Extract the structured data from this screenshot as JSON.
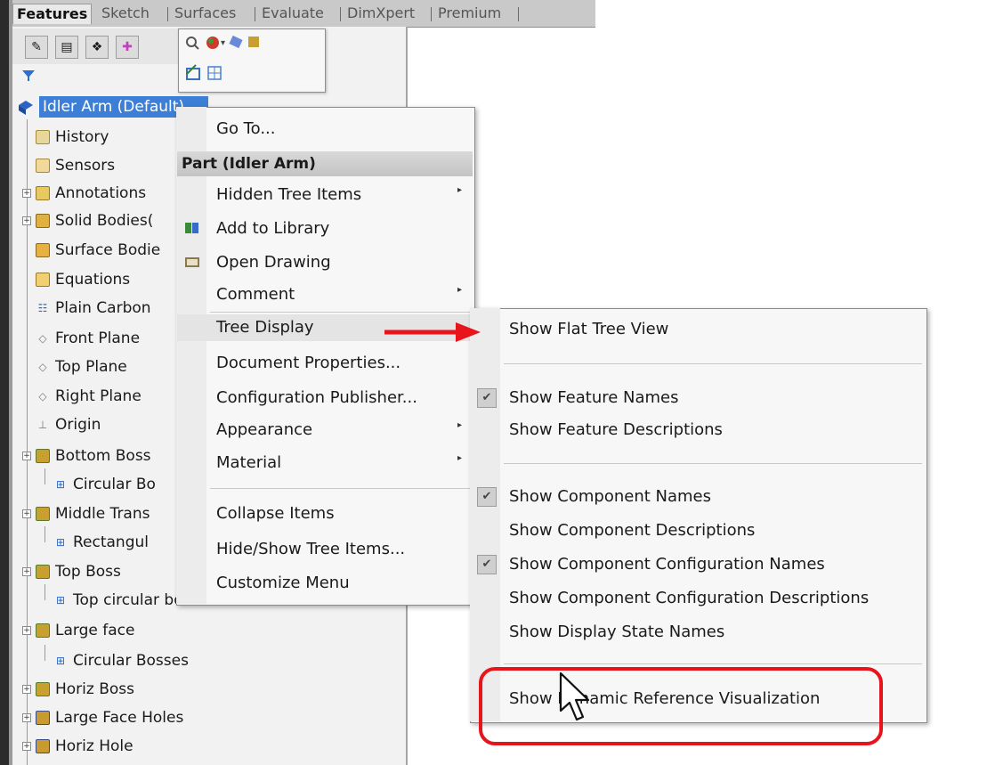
{
  "tabs": [
    {
      "label": "Features",
      "active": true
    },
    {
      "label": "Sketch",
      "active": false
    },
    {
      "label": "Surfaces",
      "active": false
    },
    {
      "label": "Evaluate",
      "active": false
    },
    {
      "label": "DimXpert",
      "active": false
    },
    {
      "label": "Premium",
      "active": false
    }
  ],
  "tree": {
    "root_label": "Idler Arm  (Default)",
    "items": [
      {
        "label": "History",
        "icon": "history-icon"
      },
      {
        "label": "Sensors",
        "icon": "sensors-icon"
      },
      {
        "label": "Annotations",
        "icon": "annotations-icon"
      },
      {
        "label": "Solid Bodies(",
        "icon": "solid-bodies-icon"
      },
      {
        "label": "Surface Bodie",
        "icon": "surface-bodies-icon"
      },
      {
        "label": "Equations",
        "icon": "equations-icon"
      },
      {
        "label": "Plain Carbon",
        "icon": "material-icon"
      },
      {
        "label": "Front Plane",
        "icon": "plane-icon"
      },
      {
        "label": "Top Plane",
        "icon": "plane-icon"
      },
      {
        "label": "Right Plane",
        "icon": "plane-icon"
      },
      {
        "label": "Origin",
        "icon": "origin-icon"
      },
      {
        "label": "Bottom Boss",
        "icon": "boss-extrude-icon"
      },
      {
        "label": "Circular Bo",
        "icon": "sketch-icon"
      },
      {
        "label": "Middle Trans",
        "icon": "boss-extrude-icon"
      },
      {
        "label": "Rectangul",
        "icon": "sketch-icon"
      },
      {
        "label": "Top Boss",
        "icon": "boss-extrude-icon"
      },
      {
        "label": "Top circular boss",
        "icon": "sketch-icon"
      },
      {
        "label": "Large face",
        "icon": "boss-extrude-icon"
      },
      {
        "label": "Circular Bosses",
        "icon": "sketch-icon"
      },
      {
        "label": "Horiz Boss",
        "icon": "boss-extrude-icon"
      },
      {
        "label": "Large Face Holes",
        "icon": "cut-extrude-icon"
      },
      {
        "label": "Horiz Hole",
        "icon": "cut-extrude-icon"
      }
    ]
  },
  "context_menu": {
    "go_to": "Go To...",
    "header": "Part (Idler Arm)",
    "hidden_tree_items": "Hidden Tree Items",
    "add_to_library": "Add to Library",
    "open_drawing": "Open Drawing",
    "comment": "Comment",
    "tree_display": "Tree Display",
    "document_properties": "Document Properties...",
    "configuration_publisher": "Configuration Publisher...",
    "appearance": "Appearance",
    "material": "Material",
    "collapse_items": "Collapse Items",
    "hide_show_tree_items": "Hide/Show Tree Items...",
    "customize_menu": "Customize Menu"
  },
  "submenu": {
    "show_flat_tree_view": "Show Flat Tree View",
    "show_feature_names": "Show Feature Names",
    "show_feature_descriptions": "Show Feature Descriptions",
    "show_component_names": "Show Component Names",
    "show_component_descriptions": "Show Component Descriptions",
    "show_component_configuration_names": "Show Component Configuration Names",
    "show_component_configuration_descriptions": "Show Component Configuration Descriptions",
    "show_display_state_names": "Show Display State Names",
    "show_dynamic_reference_visualization": "Show Dynamic Reference Visualization"
  },
  "colors": {
    "annotation_red": "#e8141c",
    "selection_blue": "#3d7fd6"
  }
}
